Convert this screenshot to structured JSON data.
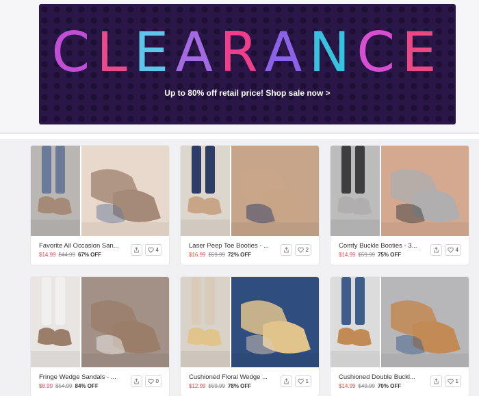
{
  "banner": {
    "title_letters": [
      {
        "ch": "C",
        "color": "#c14fd6"
      },
      {
        "ch": "L",
        "color": "#e84a8b"
      },
      {
        "ch": "E",
        "color": "#5cc7e8"
      },
      {
        "ch": "A",
        "color": "#a36be0"
      },
      {
        "ch": "R",
        "color": "#ef3f8c"
      },
      {
        "ch": "A",
        "color": "#8a63e6"
      },
      {
        "ch": "N",
        "color": "#37c2df"
      },
      {
        "ch": "C",
        "color": "#d54fd1"
      },
      {
        "ch": "E",
        "color": "#ee4786"
      }
    ],
    "subtitle": "Up to 80% off retail price! Shop sale now >"
  },
  "products": [
    {
      "title": "Favorite All Occasion San...",
      "sale": "$14.99",
      "orig": "$44.99",
      "off": "67% OFF",
      "likes": "4",
      "palette": [
        "#b9b6b3",
        "#e9d9cc",
        "#6a7a98",
        "#a58a78"
      ]
    },
    {
      "title": "Laser Peep Toe Booties - ...",
      "sale": "$16.99",
      "orig": "$59.99",
      "off": "72% OFF",
      "likes": "2",
      "palette": [
        "#ddd6cd",
        "#c7a58a",
        "#2d3d66",
        "#c9a588"
      ]
    },
    {
      "title": "Comfy Buckle Booties - 3...",
      "sale": "$14.99",
      "orig": "$59.99",
      "off": "75% OFF",
      "likes": "4",
      "palette": [
        "#bdbcbc",
        "#d4a990",
        "#3e3e40",
        "#b0aeae"
      ]
    },
    {
      "title": "Fringe Wedge Sandals - ...",
      "sale": "$8.99",
      "orig": "$54.99",
      "off": "84% OFF",
      "likes": "0",
      "palette": [
        "#e8e5e3",
        "#a39187",
        "#f2f0ee",
        "#9a7e6a"
      ]
    },
    {
      "title": "Cushioned Floral Wedge ...",
      "sale": "$12.99",
      "orig": "$59.99",
      "off": "78% OFF",
      "likes": "1",
      "palette": [
        "#d8d2c8",
        "#2f4d7e",
        "#d9cbb9",
        "#e1c48c"
      ]
    },
    {
      "title": "Cushioned Double Buckl...",
      "sale": "$14.99",
      "orig": "$49.99",
      "off": "70% OFF",
      "likes": "1",
      "palette": [
        "#dcdcdc",
        "#b7b7b9",
        "#3f5d8a",
        "#c28a54"
      ]
    }
  ],
  "icons": {
    "share": "share-icon",
    "like": "heart-icon"
  }
}
